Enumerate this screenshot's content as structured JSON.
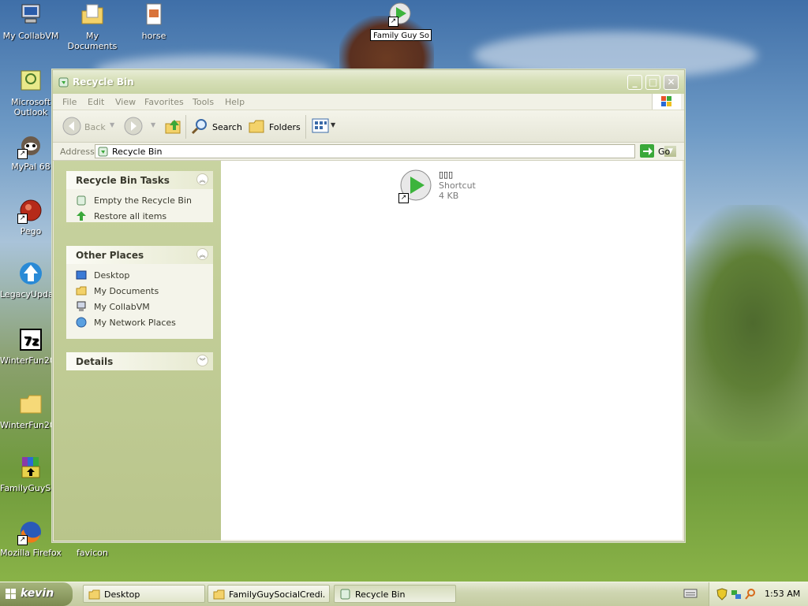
{
  "desktop": {
    "icons": [
      {
        "label": "My CollabVM",
        "icon": "computer-icon"
      },
      {
        "label": "My Documents",
        "icon": "documents-folder-icon"
      },
      {
        "label": "horse",
        "icon": "image-file-icon"
      },
      {
        "label": "Microsoft Outlook",
        "icon": "outlook-icon"
      },
      {
        "label": "MyPal 68",
        "icon": "mypal-browser-icon"
      },
      {
        "label": "Pego",
        "icon": "pego-icon"
      },
      {
        "label": "LegacyUpda...",
        "icon": "legacy-update-icon"
      },
      {
        "label": "WinterFun20...",
        "icon": "7zip-archive-icon"
      },
      {
        "label": "WinterFun20...",
        "icon": "folder-icon"
      },
      {
        "label": "FamilyGuySo...",
        "icon": "winrar-archive-icon"
      },
      {
        "label": "Mozilla Firefox",
        "icon": "firefox-icon"
      },
      {
        "label": "favicon",
        "icon": "image-file-icon"
      }
    ],
    "renaming_item": {
      "value": "Family Guy So",
      "icon": "media-player-shortcut-icon"
    }
  },
  "window": {
    "title": "Recycle Bin",
    "menu": [
      "File",
      "Edit",
      "View",
      "Favorites",
      "Tools",
      "Help"
    ],
    "toolbar": {
      "back": "Back",
      "search": "Search",
      "folders": "Folders"
    },
    "address": {
      "label": "Address",
      "value": "Recycle Bin",
      "go": "Go"
    },
    "left_pane": {
      "tasks_title": "Recycle Bin Tasks",
      "tasks": [
        "Empty the Recycle Bin",
        "Restore all items"
      ],
      "places_title": "Other Places",
      "places": [
        "Desktop",
        "My Documents",
        "My CollabVM",
        "My Network Places"
      ],
      "details_title": "Details"
    },
    "files": [
      {
        "name": "▯▯▯",
        "type": "Shortcut",
        "size": "4 KB"
      }
    ]
  },
  "taskbar": {
    "start_label": "kevin",
    "tasks": [
      "Desktop",
      "FamilyGuySocialCredi...",
      "Recycle Bin"
    ],
    "active_task": 2,
    "clock": "1:53 AM"
  },
  "colors": {
    "window_title_bg": "#d6dfb7",
    "left_pane_bg": "#c8d3a0",
    "taskbar_bg": "#cfd6b2"
  }
}
